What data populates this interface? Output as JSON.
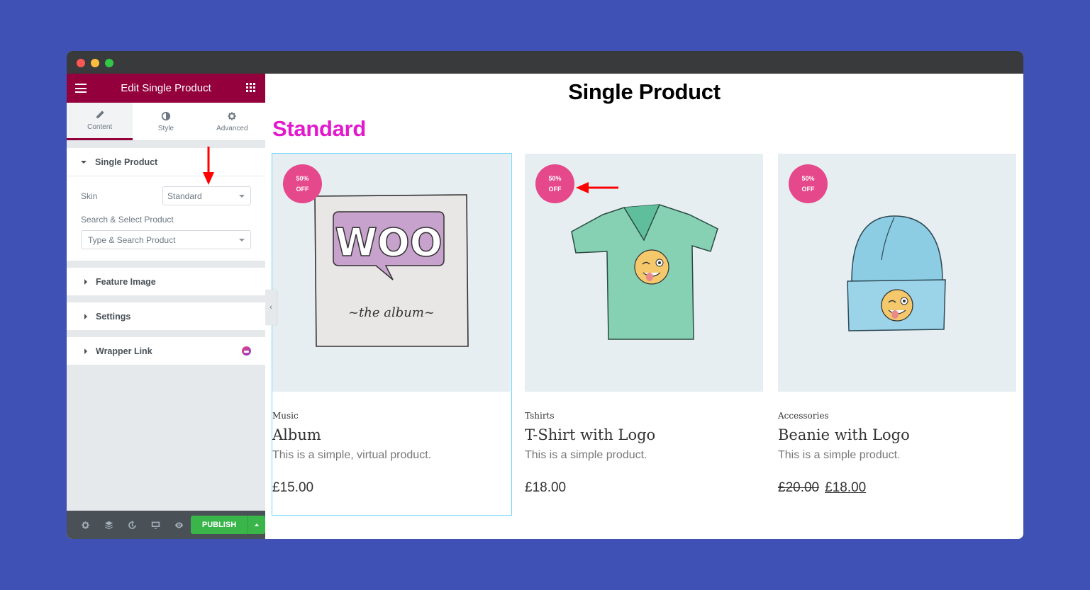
{
  "window": {
    "controls": [
      "close",
      "minimize",
      "maximize"
    ]
  },
  "sidebar": {
    "header_title": "Edit Single Product",
    "tabs": [
      {
        "label": "Content",
        "icon": "pencil-icon",
        "active": true
      },
      {
        "label": "Style",
        "icon": "contrast-icon",
        "active": false
      },
      {
        "label": "Advanced",
        "icon": "gear-icon",
        "active": false
      }
    ],
    "single_product_section": {
      "title": "Single Product",
      "skin_label": "Skin",
      "skin_value": "Standard",
      "search_label": "Search & Select Product",
      "search_placeholder": "Type & Search Product"
    },
    "collapsed_sections": [
      {
        "title": "Feature Image"
      },
      {
        "title": "Settings"
      },
      {
        "title": "Wrapper Link",
        "pro_badge": true
      }
    ],
    "footer": {
      "icons": [
        "settings-icon",
        "layers-icon",
        "history-icon",
        "responsive-icon",
        "preview-icon"
      ],
      "publish_label": "PUBLISH"
    }
  },
  "canvas": {
    "page_title": "Single Product",
    "skin_heading": "Standard",
    "products": [
      {
        "category": "Music",
        "name": "Album",
        "description": "This is a simple, virtual product.",
        "price": "£15.00",
        "old_price": null,
        "badge_line1": "50%",
        "badge_line2": "OFF",
        "image": "woo-album"
      },
      {
        "category": "Tshirts",
        "name": "T-Shirt with Logo",
        "description": "This is a simple product.",
        "price": "£18.00",
        "old_price": null,
        "badge_line1": "50%",
        "badge_line2": "OFF",
        "image": "tshirt"
      },
      {
        "category": "Accessories",
        "name": "Beanie with Logo",
        "description": "This is a simple product.",
        "price": "£18.00",
        "old_price": "£20.00",
        "badge_line1": "50%",
        "badge_line2": "OFF",
        "image": "beanie"
      }
    ]
  },
  "colors": {
    "background": "#3f51b5",
    "editor_header": "#93003c",
    "publish": "#39b54a",
    "skin_heading": "#e319cd",
    "sale_badge": "#e5488b",
    "annotation_arrow": "#ff0000"
  }
}
